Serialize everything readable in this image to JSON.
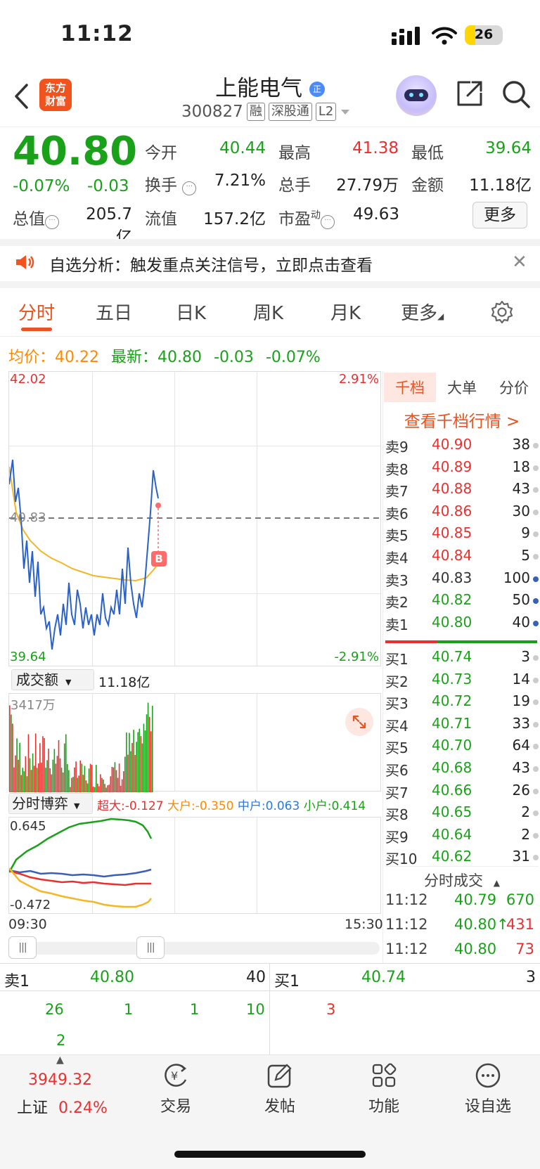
{
  "status_bar": {
    "time": "11:12",
    "battery": "26"
  },
  "header": {
    "logo_line1": "东方",
    "logo_line2": "财富",
    "name": "上能电气",
    "name_badge": "正",
    "code": "300827",
    "tags": [
      "融",
      "深股通",
      "L2"
    ]
  },
  "quote": {
    "price": "40.80",
    "change_pct": "-0.07%",
    "change": "-0.03",
    "fields": {
      "open_label": "今开",
      "open": "40.44",
      "high_label": "最高",
      "high": "41.38",
      "low_label": "最低",
      "low": "39.64",
      "turnover_label": "换手",
      "turnover": "7.21%",
      "volume_label": "总手",
      "volume": "27.79万",
      "amount_label": "金额",
      "amount": "11.18亿",
      "total_mv_label": "总值",
      "total_mv": "205.7亿",
      "float_mv_label": "流值",
      "float_mv": "157.2亿",
      "pe_label": "市盈",
      "pe_sup": "动",
      "pe": "49.63"
    },
    "more_label": "更多"
  },
  "notice": {
    "text": "自选分析：触发重点关注信号，立即点击查看"
  },
  "tabs": [
    {
      "label": "分时"
    },
    {
      "label": "五日"
    },
    {
      "label": "日K"
    },
    {
      "label": "周K"
    },
    {
      "label": "月K"
    },
    {
      "label": "更多"
    }
  ],
  "info_row": {
    "avg_label": "均价：",
    "avg": "40.22",
    "last_label": "最新：",
    "last": "40.80",
    "chg": "-0.03",
    "chg_pct": "-0.07%"
  },
  "intraday_chart": {
    "y_max": "42.02",
    "y_min": "39.64",
    "y_ref": "40.83",
    "pct_max": "2.91%",
    "pct_min": "-2.91%",
    "marker": "B",
    "x_start": "09:30",
    "x_end": "15:30"
  },
  "volume_panel": {
    "selector": "成交额",
    "total": "11.18亿",
    "max_label": "3417万"
  },
  "game_panel": {
    "selector": "分时博弈",
    "super_label": "超大:",
    "super": "-0.127",
    "large_label": "大户:",
    "large": "-0.350",
    "mid_label": "中户:",
    "mid": "0.063",
    "small_label": "小户:",
    "small": "0.414",
    "y_max": "0.645",
    "y_min": "-0.472"
  },
  "order_book": {
    "tabs": [
      "千档",
      "大单",
      "分价"
    ],
    "link": "查看千档行情 >",
    "asks": [
      {
        "label": "卖9",
        "price": "40.90",
        "vol": "38"
      },
      {
        "label": "卖8",
        "price": "40.89",
        "vol": "18"
      },
      {
        "label": "卖7",
        "price": "40.88",
        "vol": "43"
      },
      {
        "label": "卖6",
        "price": "40.86",
        "vol": "30"
      },
      {
        "label": "卖5",
        "price": "40.85",
        "vol": "9"
      },
      {
        "label": "卖4",
        "price": "40.84",
        "vol": "5"
      },
      {
        "label": "卖3",
        "price": "40.83",
        "vol": "100"
      },
      {
        "label": "卖2",
        "price": "40.82",
        "vol": "50"
      },
      {
        "label": "卖1",
        "price": "40.80",
        "vol": "40"
      }
    ],
    "bids": [
      {
        "label": "买1",
        "price": "40.74",
        "vol": "3"
      },
      {
        "label": "买2",
        "price": "40.73",
        "vol": "14"
      },
      {
        "label": "买3",
        "price": "40.72",
        "vol": "19"
      },
      {
        "label": "买4",
        "price": "40.71",
        "vol": "33"
      },
      {
        "label": "买5",
        "price": "40.70",
        "vol": "64"
      },
      {
        "label": "买6",
        "price": "40.68",
        "vol": "43"
      },
      {
        "label": "买7",
        "price": "40.66",
        "vol": "26"
      },
      {
        "label": "买8",
        "price": "40.65",
        "vol": "2"
      },
      {
        "label": "买9",
        "price": "40.64",
        "vol": "2"
      },
      {
        "label": "买10",
        "price": "40.62",
        "vol": "31"
      }
    ]
  },
  "trades": {
    "header": "分时成交",
    "rows": [
      {
        "time": "11:12",
        "price": "40.79",
        "vol": "670"
      },
      {
        "time": "11:12",
        "price": "40.80↑",
        "vol": "431"
      },
      {
        "time": "11:12",
        "price": "40.80",
        "vol": "73"
      }
    ]
  },
  "level1": {
    "sell_label": "卖1",
    "sell_price": "40.80",
    "sell_vol": "40",
    "buy_label": "买1",
    "buy_price": "40.74",
    "buy_vol": "3",
    "sell_queue": [
      "26",
      "1",
      "1",
      "10",
      "2"
    ],
    "buy_queue": [
      "3"
    ]
  },
  "bottom_nav": {
    "index_value": "3949.32",
    "index_name": "上证",
    "index_pct": "0.24%",
    "items": [
      "交易",
      "发帖",
      "功能",
      "设自选"
    ]
  }
}
